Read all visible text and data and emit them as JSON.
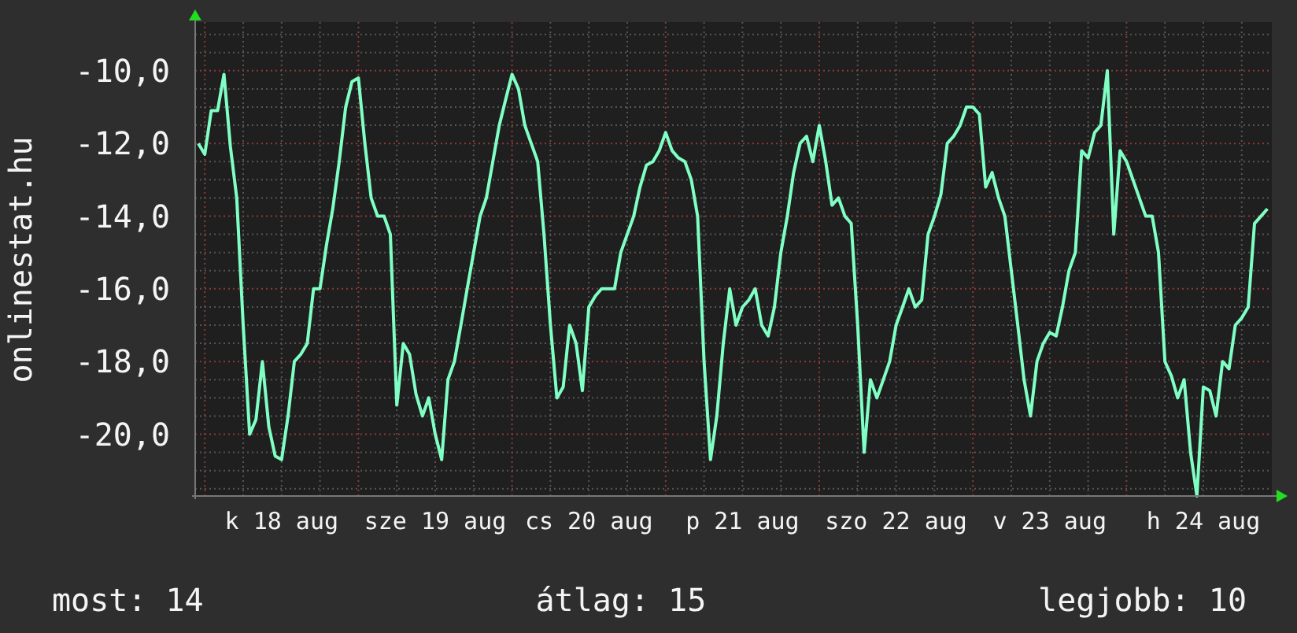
{
  "chart": {
    "chart_data": {
      "type": "line",
      "ylabel": "onlinestat.hu",
      "grid": true,
      "ylim": [
        -21.7,
        -8.66
      ],
      "yticks": [
        {
          "value": -10,
          "label": "-10,0"
        },
        {
          "value": -12,
          "label": "-12,0"
        },
        {
          "value": -14,
          "label": "-14,0"
        },
        {
          "value": -16,
          "label": "-16,0"
        },
        {
          "value": -18,
          "label": "-18,0"
        },
        {
          "value": -20,
          "label": "-20,0"
        }
      ],
      "categories": [
        null,
        null,
        null,
        null,
        null,
        null,
        null,
        null,
        null,
        null,
        null,
        null,
        null,
        "k 18 aug",
        null,
        null,
        null,
        null,
        null,
        null,
        null,
        null,
        null,
        null,
        null,
        null,
        null,
        null,
        null,
        null,
        null,
        null,
        null,
        null,
        null,
        null,
        null,
        "sze 19 aug",
        null,
        null,
        null,
        null,
        null,
        null,
        null,
        null,
        null,
        null,
        null,
        null,
        null,
        null,
        null,
        null,
        null,
        null,
        null,
        null,
        null,
        null,
        null,
        "cs 20 aug",
        null,
        null,
        null,
        null,
        null,
        null,
        null,
        null,
        null,
        null,
        null,
        null,
        null,
        null,
        null,
        null,
        null,
        null,
        null,
        null,
        null,
        null,
        null,
        "p 21 aug",
        null,
        null,
        null,
        null,
        null,
        null,
        null,
        null,
        null,
        null,
        null,
        null,
        null,
        null,
        null,
        null,
        null,
        null,
        null,
        null,
        null,
        null,
        null,
        "szo 22 aug",
        null,
        null,
        null,
        null,
        null,
        null,
        null,
        null,
        null,
        null,
        null,
        null,
        null,
        null,
        null,
        null,
        null,
        null,
        null,
        null,
        null,
        null,
        null,
        "v 23 aug",
        null,
        null,
        null,
        null,
        null,
        null,
        null,
        null,
        null,
        null,
        null,
        null,
        null,
        null,
        null,
        null,
        null,
        null,
        null,
        null,
        null,
        null,
        null,
        "h 24 aug",
        null,
        null,
        null,
        null,
        null,
        null,
        null,
        null,
        null,
        null
      ],
      "series": [
        {
          "color": "#80ffc4",
          "values": [
            -12,
            -12.3,
            -11.1,
            -11.1,
            -10.1,
            -12.1,
            -13.5,
            -17,
            -20,
            -19.6,
            -18,
            -19.8,
            -20.6,
            -20.7,
            -19.5,
            -18,
            -17.8,
            -17.5,
            -16,
            -16,
            -14.8,
            -13.8,
            -12.5,
            -11,
            -10.3,
            -10.2,
            -12,
            -13.5,
            -14,
            -14,
            -14.5,
            -19.2,
            -17.5,
            -17.8,
            -18.9,
            -19.5,
            -19,
            -20,
            -20.7,
            -18.5,
            -18,
            -17,
            -16,
            -15,
            -14,
            -13.5,
            -12.5,
            -11.5,
            -10.8,
            -10.1,
            -10.5,
            -11.5,
            -12,
            -12.5,
            -14.5,
            -17,
            -19,
            -18.7,
            -17,
            -17.5,
            -18.8,
            -16.5,
            -16.2,
            -16,
            -16,
            -16,
            -15,
            -14.5,
            -14,
            -13.2,
            -12.6,
            -12.5,
            -12.2,
            -11.7,
            -12.2,
            -12.4,
            -12.5,
            -13,
            -14,
            -18,
            -20.7,
            -19.5,
            -17.5,
            -16,
            -17,
            -16.5,
            -16.3,
            -16,
            -17,
            -17.3,
            -16.5,
            -15,
            -14,
            -12.8,
            -12,
            -11.8,
            -12.5,
            -11.5,
            -12.5,
            -13.7,
            -13.5,
            -14,
            -14.2,
            -17,
            -20.5,
            -18.5,
            -19,
            -18.5,
            -18,
            -17,
            -16.5,
            -16,
            -16.5,
            -16.3,
            -14.5,
            -14,
            -13.4,
            -12,
            -11.8,
            -11.5,
            -11,
            -11,
            -11.2,
            -13.2,
            -12.8,
            -13.5,
            -14,
            -15.5,
            -17,
            -18.5,
            -19.5,
            -18,
            -17.5,
            -17.2,
            -17.3,
            -16.5,
            -15.5,
            -15,
            -12.2,
            -12.4,
            -11.7,
            -11.5,
            -10,
            -14.5,
            -12.2,
            -12.5,
            -13,
            -13.5,
            -14,
            -14,
            -15,
            -18,
            -18.4,
            -19,
            -18.5,
            -20.5,
            -21.7,
            -18.7,
            -18.8,
            -19.5,
            -18,
            -18.2,
            -17,
            -16.8,
            -16.5,
            -14.2,
            -14,
            -13.8
          ]
        }
      ]
    }
  },
  "stats": [
    "most: 14",
    "átlag: 15",
    "legjobb: 10"
  ]
}
